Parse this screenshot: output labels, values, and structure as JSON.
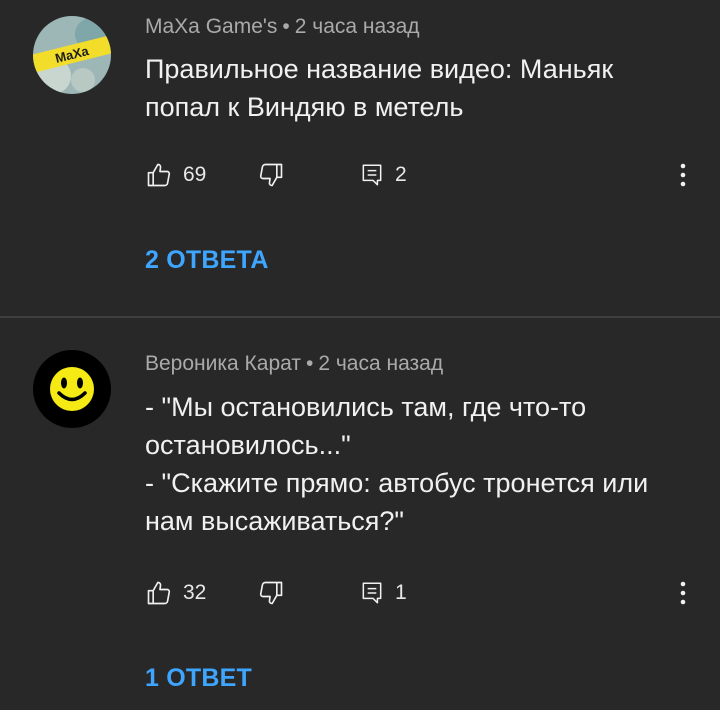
{
  "comments": [
    {
      "author": "MaXa Game's",
      "time": "2 часа назад",
      "separator": "•",
      "text_lines": [
        "Правильное название видео: Маньяк",
        "попал к Виндяю в метель"
      ],
      "likes": "69",
      "replies_count": "2",
      "replies_link": "2 ОТВЕТА",
      "avatar_text": "MaXa"
    },
    {
      "author": "Вероника Карат",
      "time": "2 часа назад",
      "separator": "•",
      "text_lines": [
        "- \"Мы остановились там, где что-то",
        "остановилось...\"",
        "- \"Скажите прямо: автобус тронется или",
        "нам высаживаться?\""
      ],
      "likes": "32",
      "replies_count": "1",
      "replies_link": "1 ОТВЕТ"
    }
  ],
  "icons": {
    "like": "thumb-up-icon",
    "dislike": "thumb-down-icon",
    "reply": "comment-icon",
    "more": "more-vert-icon"
  },
  "colors": {
    "background": "#282828",
    "link": "#3ea6ff",
    "meta": "#aaaaaa",
    "avatar2_bg": "#000000",
    "smiley": "#f5ea14"
  }
}
